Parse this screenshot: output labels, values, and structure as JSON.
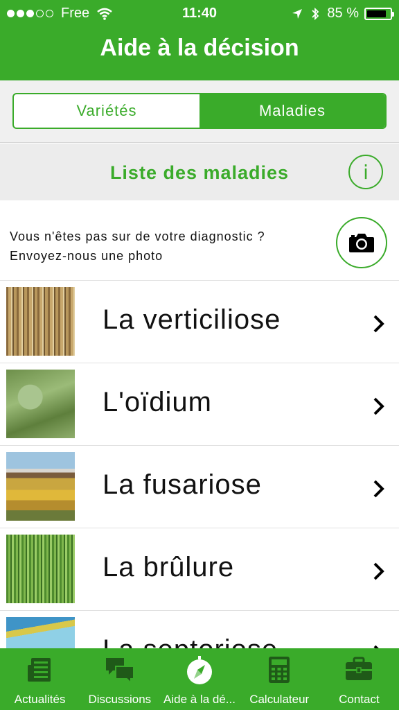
{
  "status_bar": {
    "carrier": "Free",
    "time": "11:40",
    "battery_text": "85 %",
    "battery_level": 0.85
  },
  "header": {
    "title": "Aide à la décision"
  },
  "segmented": {
    "options": [
      {
        "label": "Variétés",
        "selected": false
      },
      {
        "label": "Maladies",
        "selected": true
      }
    ]
  },
  "section": {
    "title": "Liste des maladies",
    "info_symbol": "i"
  },
  "diagnostic": {
    "line1": "Vous n'êtes pas sur de votre diagnostic ?",
    "line2": "Envoyez-nous une photo"
  },
  "diseases": [
    {
      "label": "La verticiliose",
      "image": "flax-stems-photo"
    },
    {
      "label": "L'oïdium",
      "image": "flax-plant-photo"
    },
    {
      "label": "La fusariose",
      "image": "flax-field-photo"
    },
    {
      "label": "La brûlure",
      "image": "green-stems-photo"
    },
    {
      "label": "La septoriose",
      "image": "field-sky-photo"
    }
  ],
  "tabs": [
    {
      "label": "Actualités",
      "icon": "newspaper-icon",
      "active": false
    },
    {
      "label": "Discussions",
      "icon": "chat-bubbles-icon",
      "active": false
    },
    {
      "label": "Aide à la dé...",
      "icon": "compass-icon",
      "active": true
    },
    {
      "label": "Calculateur",
      "icon": "calculator-icon",
      "active": false
    },
    {
      "label": "Contact",
      "icon": "briefcase-icon",
      "active": false
    }
  ],
  "colors": {
    "brand_green": "#3aab2a",
    "section_bg": "#ececec",
    "text": "#111111"
  }
}
